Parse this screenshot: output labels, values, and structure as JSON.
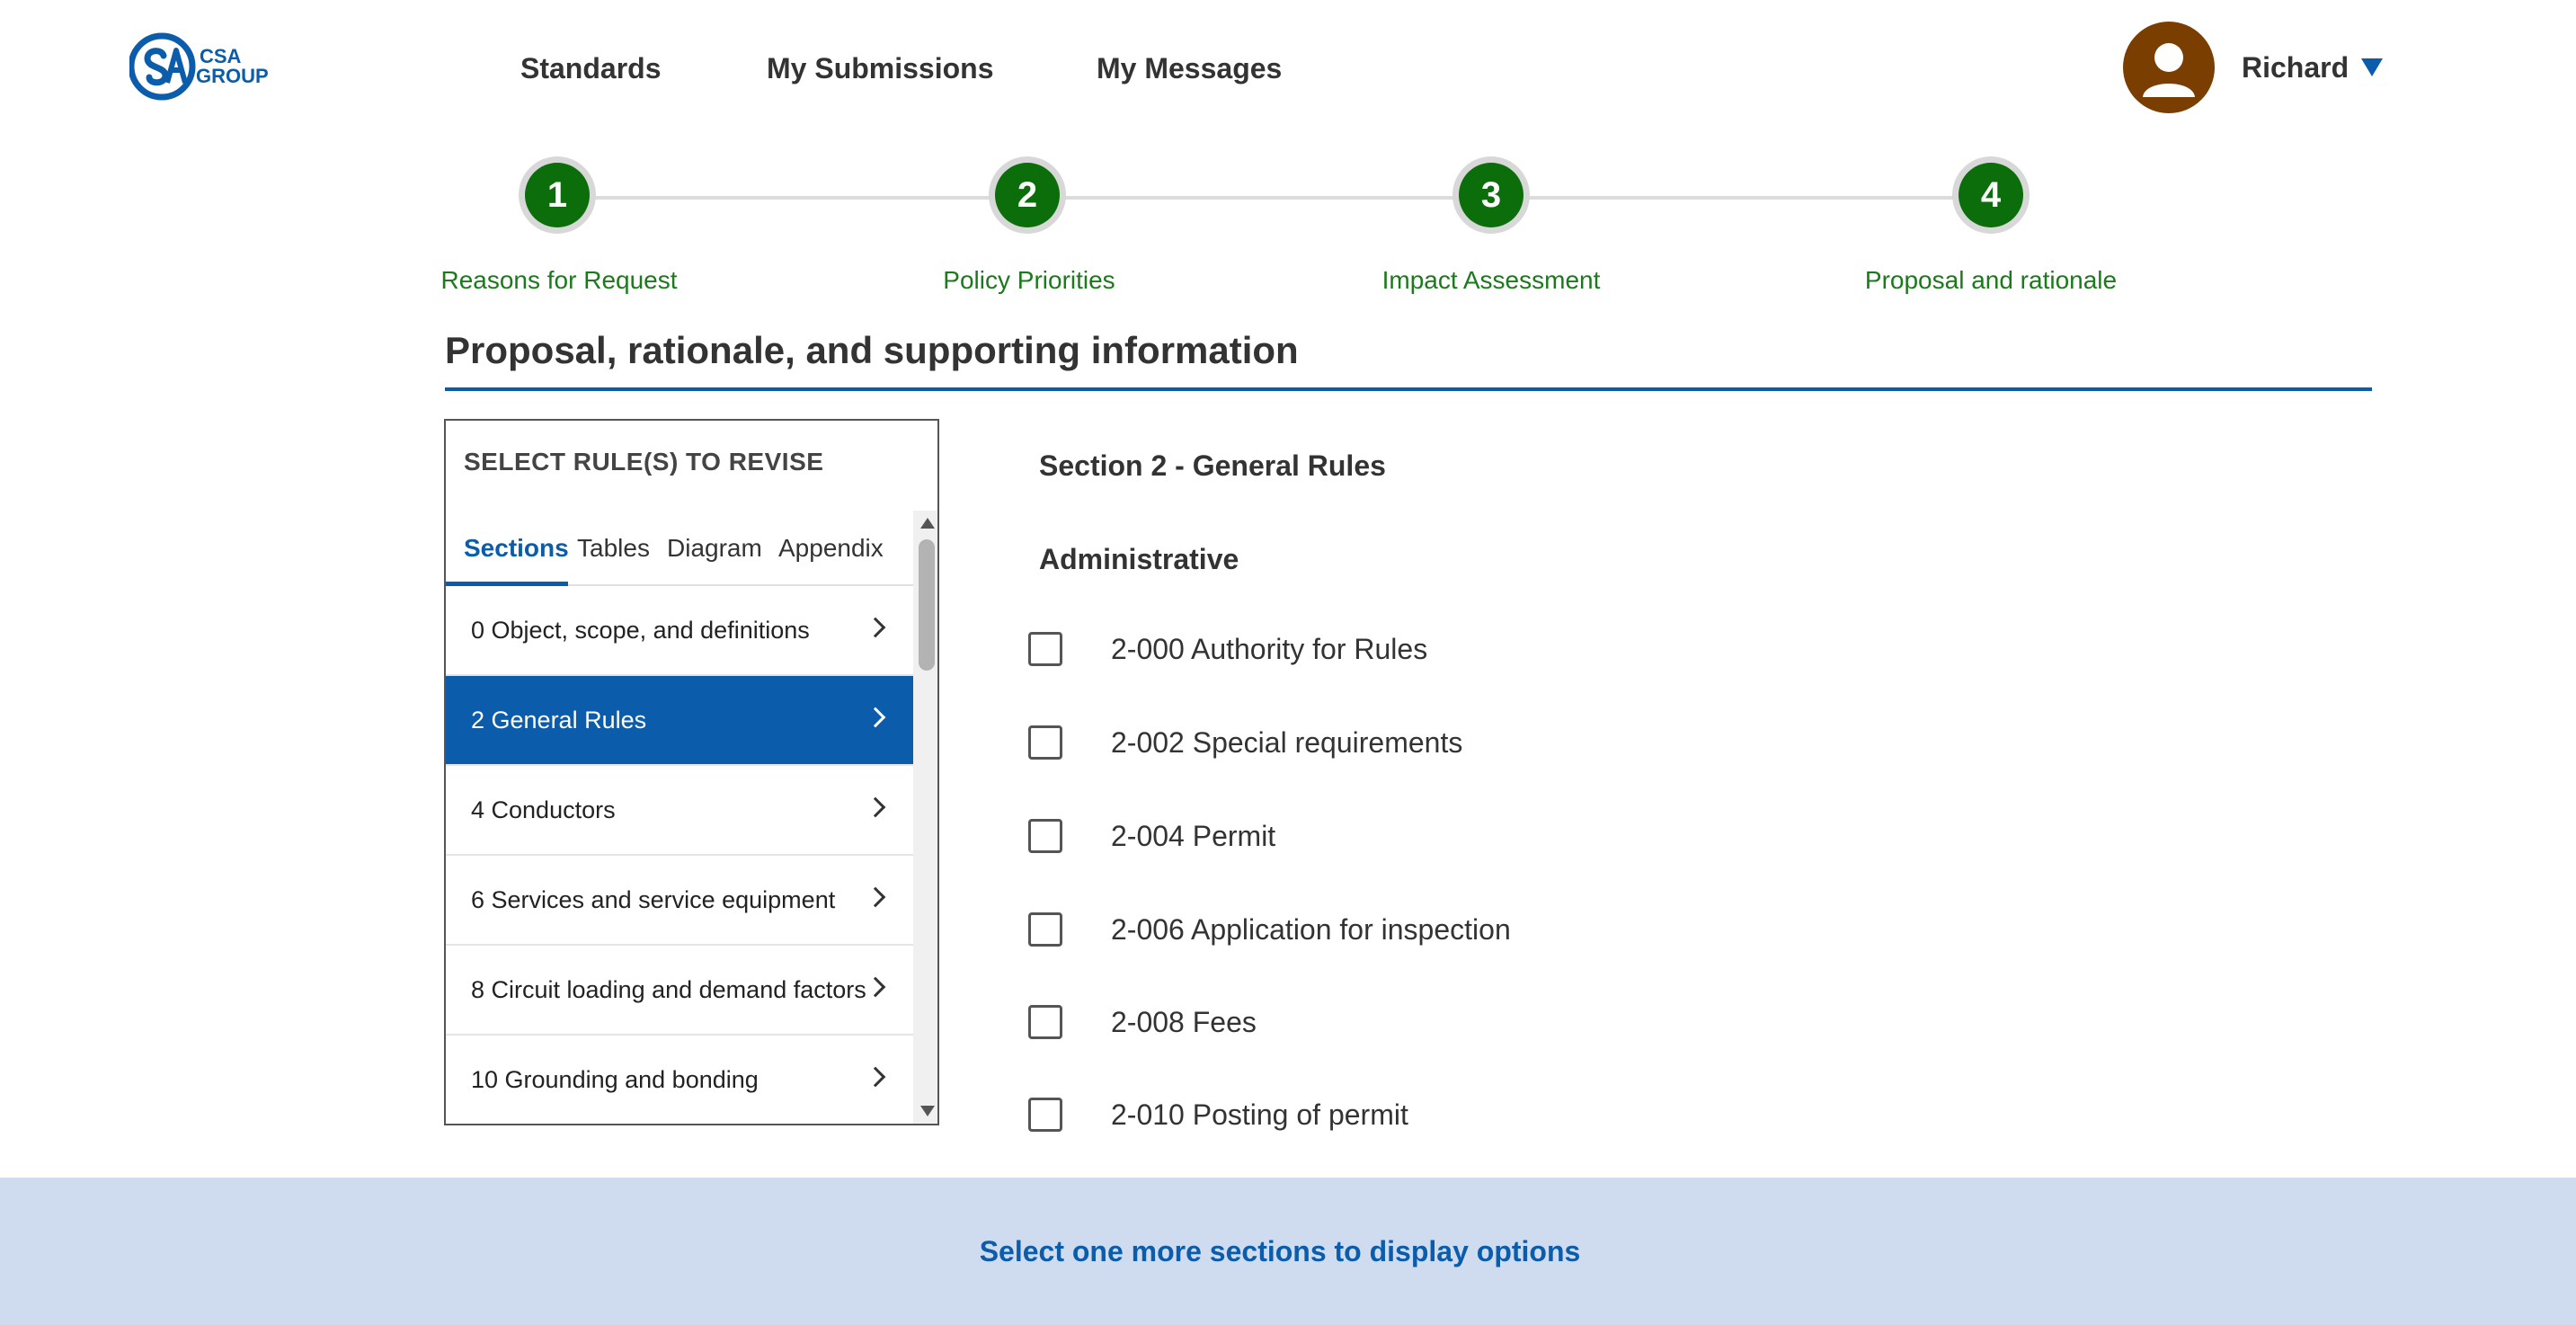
{
  "app": {
    "logo_text": "CSA GROUP"
  },
  "nav": {
    "items": [
      {
        "label": "Standards"
      },
      {
        "label": "My Submissions"
      },
      {
        "label": "My Messages"
      }
    ]
  },
  "user": {
    "name": "Richard"
  },
  "stepper": {
    "steps": [
      {
        "number": "1",
        "label": "Reasons for Request"
      },
      {
        "number": "2",
        "label": "Policy Priorities"
      },
      {
        "number": "3",
        "label": "Impact Assessment"
      },
      {
        "number": "4",
        "label": "Proposal and rationale"
      }
    ]
  },
  "page": {
    "title": "Proposal, rationale, and supporting information"
  },
  "rule_panel": {
    "title": "SELECT RULE(S) TO REVISE",
    "tabs": [
      {
        "label": "Sections",
        "active": true
      },
      {
        "label": "Tables"
      },
      {
        "label": "Diagram"
      },
      {
        "label": "Appendix"
      }
    ],
    "items": [
      {
        "label": "0 Object, scope, and definitions"
      },
      {
        "label": "2 General Rules",
        "selected": true
      },
      {
        "label": "4 Conductors"
      },
      {
        "label": "6 Services and service equipment"
      },
      {
        "label": "8 Circuit loading and demand factors"
      },
      {
        "label": "10 Grounding and bonding"
      }
    ]
  },
  "content": {
    "section_heading": "Section 2 - General Rules",
    "group_heading": "Administrative",
    "rules": [
      {
        "label": "2-000 Authority for Rules",
        "checked": false
      },
      {
        "label": "2-002 Special requirements",
        "checked": false
      },
      {
        "label": "2-004 Permit",
        "checked": false
      },
      {
        "label": "2-006 Application for inspection",
        "checked": false
      },
      {
        "label": "2-008 Fees",
        "checked": false
      },
      {
        "label": "2-010 Posting of permit",
        "checked": false
      }
    ]
  },
  "footer_bar": {
    "message": "Select one more sections to display options"
  },
  "colors": {
    "brand_blue": "#0b5cab",
    "step_green": "#0b6e0b",
    "step_label_green": "#1b7a1b",
    "avatar_brown": "#7a3f00",
    "bottom_bar": "#cfdbee"
  }
}
